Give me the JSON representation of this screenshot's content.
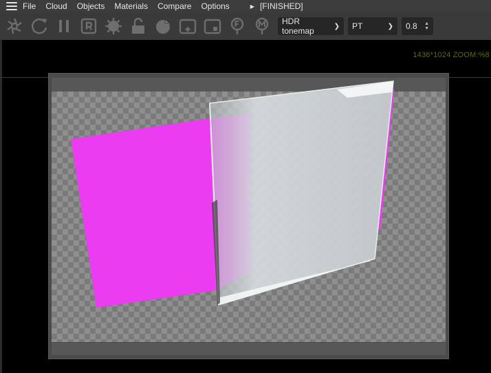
{
  "menubar": {
    "items": [
      "File",
      "Cloud",
      "Objects",
      "Materials",
      "Compare",
      "Options"
    ],
    "status": "[FINISHED]"
  },
  "toolbar": {
    "icons": [
      "aperture-icon",
      "refresh-icon",
      "pause-icon",
      "region-icon",
      "settings-gear-icon",
      "unlock-icon",
      "sphere-icon",
      "add-frame-icon",
      "frame-icon",
      "focus-pick-icon",
      "material-pick-icon"
    ],
    "tonemap_select": "HDR tonemap",
    "mode_select": "PT",
    "exposure_value": "0.8"
  },
  "viewport": {
    "resolution_readout": "1436*1024 ZOOM:%8"
  },
  "colors": {
    "accent_magenta": "#ec3cf2",
    "glass": "#c8ced0",
    "resolution_text": "#5e6a1d"
  }
}
